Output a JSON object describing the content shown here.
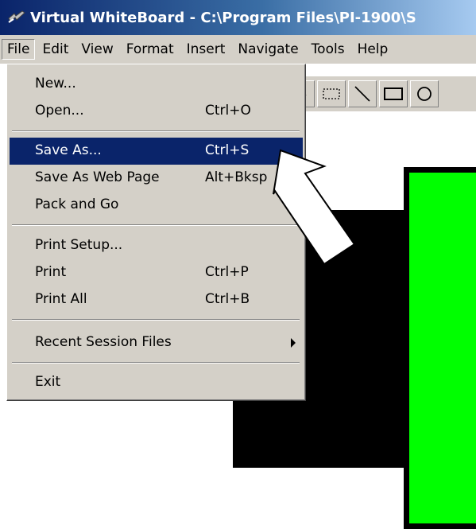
{
  "window": {
    "title": "Virtual WhiteBoard  -  C:\\Program Files\\PI-1900\\S"
  },
  "menubar": {
    "items": [
      {
        "label": "File"
      },
      {
        "label": "Edit"
      },
      {
        "label": "View"
      },
      {
        "label": "Format"
      },
      {
        "label": "Insert"
      },
      {
        "label": "Navigate"
      },
      {
        "label": "Tools"
      },
      {
        "label": "Help"
      }
    ]
  },
  "file_menu": {
    "items": [
      {
        "label": "New...",
        "shortcut": ""
      },
      {
        "label": "Open...",
        "shortcut": "Ctrl+O"
      },
      {
        "label": "Save As...",
        "shortcut": "Ctrl+S"
      },
      {
        "label": "Save As Web Page",
        "shortcut": "Alt+Bksp"
      },
      {
        "label": "Pack and Go",
        "shortcut": ""
      },
      {
        "label": "Print Setup...",
        "shortcut": ""
      },
      {
        "label": "Print",
        "shortcut": "Ctrl+P"
      },
      {
        "label": "Print All",
        "shortcut": "Ctrl+B"
      },
      {
        "label": "Recent Session Files",
        "shortcut": ""
      },
      {
        "label": "Exit",
        "shortcut": ""
      }
    ]
  },
  "colors": {
    "highlight": "#0a246a",
    "menu_bg": "#d4d0c8",
    "shape_green": "#00ff00",
    "shape_black": "#000000"
  },
  "icons": [
    "app-icon",
    "pointer-tool-icon",
    "select-rectangle-icon",
    "line-tool-icon",
    "rectangle-tool-icon",
    "ellipse-tool-icon",
    "submenu-arrow-icon"
  ]
}
